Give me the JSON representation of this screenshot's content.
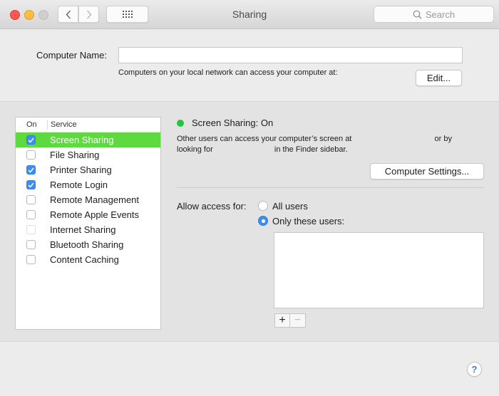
{
  "window": {
    "title": "Sharing",
    "search_placeholder": "Search",
    "controls": [
      "close",
      "minimize",
      "zoom-disabled"
    ],
    "nav": {
      "back_icon": "chevron-left-icon",
      "forward_icon": "chevron-right-icon",
      "show_all_icon": "grid-icon"
    }
  },
  "computer_name": {
    "label": "Computer Name:",
    "value": "",
    "network_info": "Computers on your local network can access your computer at:",
    "edit_label": "Edit..."
  },
  "services": {
    "col_on": "On",
    "col_service": "Service",
    "items": [
      {
        "label": "Screen Sharing",
        "checked": true,
        "selected": true,
        "enabled": true
      },
      {
        "label": "File Sharing",
        "checked": false,
        "selected": false,
        "enabled": true
      },
      {
        "label": "Printer Sharing",
        "checked": true,
        "selected": false,
        "enabled": true
      },
      {
        "label": "Remote Login",
        "checked": true,
        "selected": false,
        "enabled": true
      },
      {
        "label": "Remote Management",
        "checked": false,
        "selected": false,
        "enabled": true
      },
      {
        "label": "Remote Apple Events",
        "checked": false,
        "selected": false,
        "enabled": true
      },
      {
        "label": "Internet Sharing",
        "checked": false,
        "selected": false,
        "enabled": false
      },
      {
        "label": "Bluetooth Sharing",
        "checked": false,
        "selected": false,
        "enabled": true
      },
      {
        "label": "Content Caching",
        "checked": false,
        "selected": false,
        "enabled": true
      }
    ],
    "selected_color": "#5ed93f",
    "checkbox_color": "#3b8ff2"
  },
  "detail": {
    "status": "Screen Sharing: On",
    "status_color": "#29c140",
    "desc_part1": "Other users can access your computer’s screen at",
    "desc_part2": "or by",
    "desc_part3": "looking for",
    "desc_part4": "in the Finder sidebar.",
    "computer_settings_label": "Computer Settings...",
    "allow_label": "Allow access for:",
    "options": [
      {
        "label": "All users",
        "selected": false
      },
      {
        "label": "Only these users:",
        "selected": true
      }
    ],
    "users": [],
    "add_label": "+",
    "remove_label": "−"
  },
  "help_label": "?"
}
